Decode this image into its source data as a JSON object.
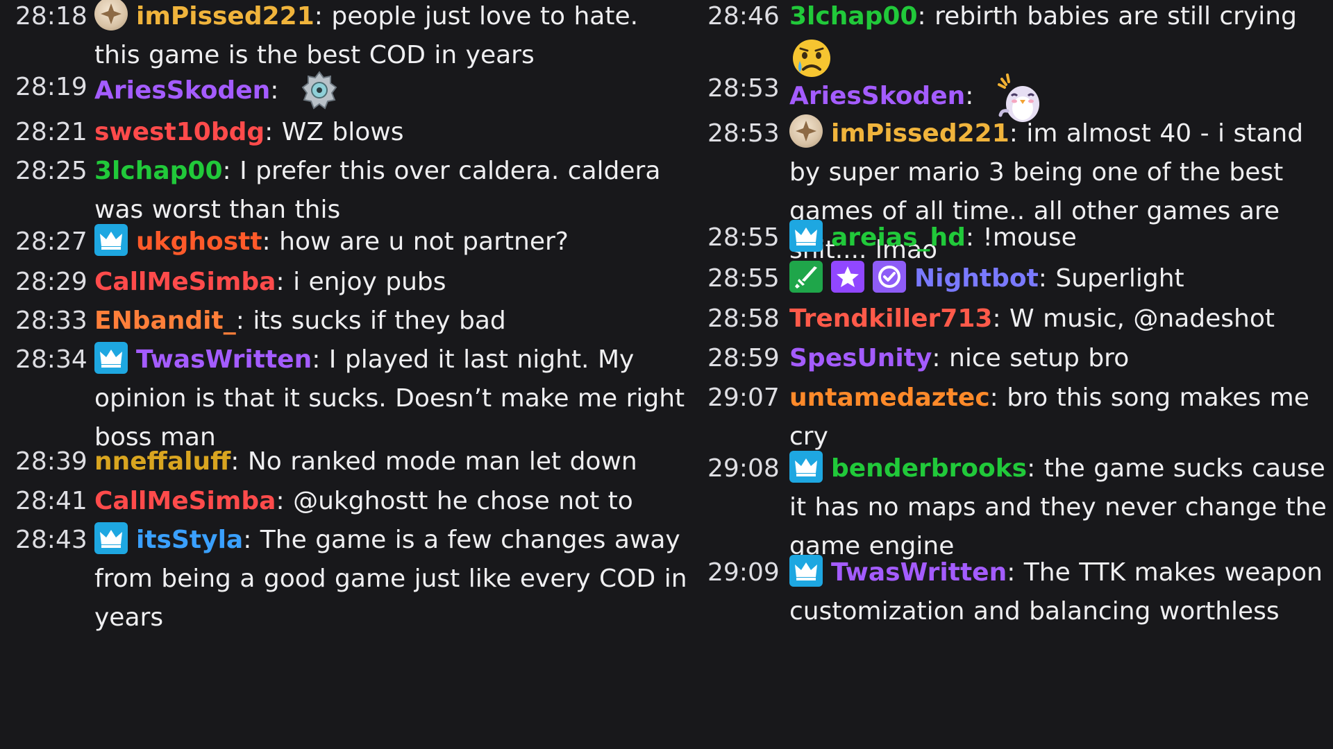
{
  "colors": {
    "background": "#18181b",
    "timestamp": "#dedee3",
    "text": "#efeff1",
    "badge_crown": "#1ea7e1",
    "badge_green": "#1fa64a",
    "badge_purple": "#9147ff"
  },
  "left": [
    {
      "time": "28:18",
      "badges": [
        "gold-medal-icon"
      ],
      "user": "imPissed221",
      "color": "#f0b43c",
      "text": "people just love to hate. this game is the best COD in years"
    },
    {
      "time": "28:19",
      "badges": [],
      "user": "AriesSkoden",
      "color": "#a45cff",
      "text": "",
      "emote": "gear-robot-emote"
    },
    {
      "time": "28:21",
      "badges": [],
      "user": "swest10bdg",
      "color": "#ff4b4b",
      "text": "WZ blows"
    },
    {
      "time": "28:25",
      "badges": [],
      "user": "3lchap00",
      "color": "#21c93a",
      "text": "I prefer this over caldera. caldera was worst than this"
    },
    {
      "time": "28:27",
      "badges": [
        "crown-icon"
      ],
      "user": "ukghostt",
      "color": "#ff5a2a",
      "text": "how are u not partner?"
    },
    {
      "time": "28:29",
      "badges": [],
      "user": "CallMeSimba",
      "color": "#ff4b4b",
      "text": "i enjoy pubs"
    },
    {
      "time": "28:33",
      "badges": [],
      "user": "ENbandit_",
      "color": "#ff7f3a",
      "text": "its sucks if they bad"
    },
    {
      "time": "28:34",
      "badges": [
        "crown-icon"
      ],
      "user": "TwasWritten",
      "color": "#a45cff",
      "text": "I played it last night. My opinion is that it sucks. Doesn’t make me right boss man"
    },
    {
      "time": "28:39",
      "badges": [],
      "user": "nneffaluff",
      "color": "#d9a520",
      "text": "No ranked mode man let down"
    },
    {
      "time": "28:41",
      "badges": [],
      "user": "CallMeSimba",
      "color": "#ff4b4b",
      "text": "@ukghostt he chose not to"
    },
    {
      "time": "28:43",
      "badges": [
        "crown-icon"
      ],
      "user": "itsStyla",
      "color": "#3aa0ff",
      "text": "The game is a few changes away from being a good game just like every COD in years"
    }
  ],
  "right": [
    {
      "time": "28:46",
      "badges": [],
      "user": "3lchap00",
      "color": "#21c93a",
      "text": "rebirth babies are still crying",
      "emote": "crying-face-emoji"
    },
    {
      "time": "28:53",
      "badges": [],
      "user": "AriesSkoden",
      "color": "#a45cff",
      "text": "",
      "emote": "penguin-emote"
    },
    {
      "time": "28:53",
      "badges": [
        "gold-medal-icon"
      ],
      "user": "imPissed221",
      "color": "#f0b43c",
      "text": "im almost 40 - i stand by super mario 3 being one of the best games of all time.. all other games are shit.... lmao"
    },
    {
      "time": "28:55",
      "badges": [
        "crown-icon"
      ],
      "user": "areias_hd",
      "color": "#21c93a",
      "text": "!mouse"
    },
    {
      "time": "28:55",
      "badges": [
        "sword-icon",
        "star-icon",
        "verified-icon"
      ],
      "user": "Nightbot",
      "color": "#7a7aff",
      "text": "Superlight"
    },
    {
      "time": "28:58",
      "badges": [],
      "user": "Trendkiller713",
      "color": "#ff5a4a",
      "text": "W music, @nadeshot"
    },
    {
      "time": "28:59",
      "badges": [],
      "user": "SpesUnity",
      "color": "#a45cff",
      "text": "nice setup bro"
    },
    {
      "time": "29:07",
      "badges": [],
      "user": "untamedaztec",
      "color": "#ff8a2a",
      "text": "bro this song makes me cry"
    },
    {
      "time": "29:08",
      "badges": [
        "crown-icon"
      ],
      "user": "benderbrooks",
      "color": "#21c93a",
      "text": "the game sucks cause it has no maps and they never change the game engine"
    },
    {
      "time": "29:09",
      "badges": [
        "crown-icon"
      ],
      "user": "TwasWritten",
      "color": "#a45cff",
      "text": "The TTK makes weapon customization and balancing worthless"
    }
  ]
}
